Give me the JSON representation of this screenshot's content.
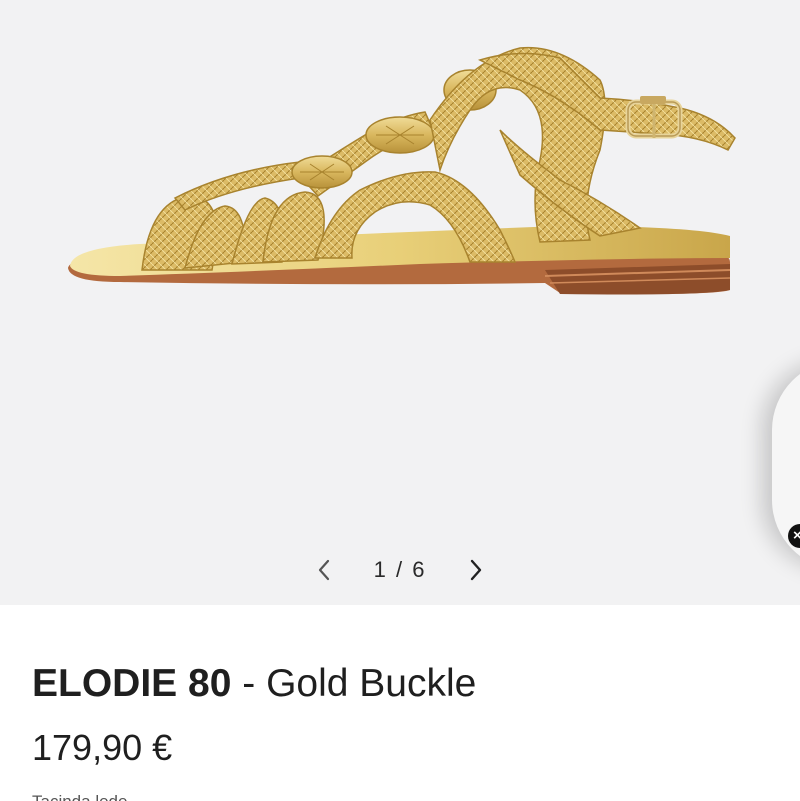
{
  "gallery": {
    "image_alt": "ELODIE 80 gold woven flat sandal with buckle",
    "current_index": "1",
    "total": "6",
    "separator": "/",
    "prev_icon": "chevron-left-icon",
    "next_icon": "chevron-right-icon"
  },
  "product": {
    "model": "ELODIE 80",
    "dash": " - ",
    "variant": "Gold Buckle",
    "price": "179,90 €",
    "cut_line": "Tacinda lede"
  },
  "overlay": {
    "close_icon": "close-icon",
    "close_glyph": "×"
  },
  "colors": {
    "gallery_bg": "#f2f2f3",
    "gold": "#d9b75e",
    "sole_brown": "#b36a3e"
  }
}
